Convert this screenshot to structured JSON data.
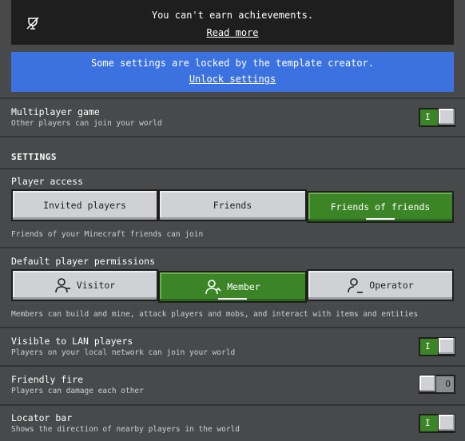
{
  "achievement": {
    "message": "You can't earn achievements.",
    "link": "Read more"
  },
  "lock_notice": {
    "message": "Some settings are locked by the template creator.",
    "link": "Unlock settings"
  },
  "multiplayer": {
    "title": "Multiplayer game",
    "subtitle": "Other players can join your world",
    "state": "on",
    "mark": "I"
  },
  "settings_header": "SETTINGS",
  "player_access": {
    "title": "Player access",
    "options": [
      "Invited players",
      "Friends",
      "Friends of friends"
    ],
    "selected": "Friends of friends",
    "description": "Friends of your Minecraft friends can join"
  },
  "default_permissions": {
    "title": "Default player permissions",
    "options": [
      "Visitor",
      "Member",
      "Operator"
    ],
    "selected": "Member",
    "description": "Members can build and mine, attack players and mobs, and interact with items and entities"
  },
  "lan": {
    "title": "Visible to LAN players",
    "subtitle": "Players on your local network can join your world",
    "state": "on",
    "mark": "I"
  },
  "friendly_fire": {
    "title": "Friendly fire",
    "subtitle": "Players can damage each other",
    "state": "off",
    "mark": "O"
  },
  "locator_bar": {
    "title": "Locator bar",
    "subtitle": "Shows the direction of nearby players in the world",
    "state": "on",
    "mark": "I"
  },
  "colors": {
    "accent_green": "#3c8527",
    "notice_blue": "#3c72e0",
    "panel_dark": "#1e1e1f",
    "background": "#48494a"
  },
  "icons": {
    "achievement": "crossed-trophy-icon",
    "visitor": "visitor-person-icon",
    "member": "member-person-icon",
    "operator": "operator-person-icon"
  }
}
